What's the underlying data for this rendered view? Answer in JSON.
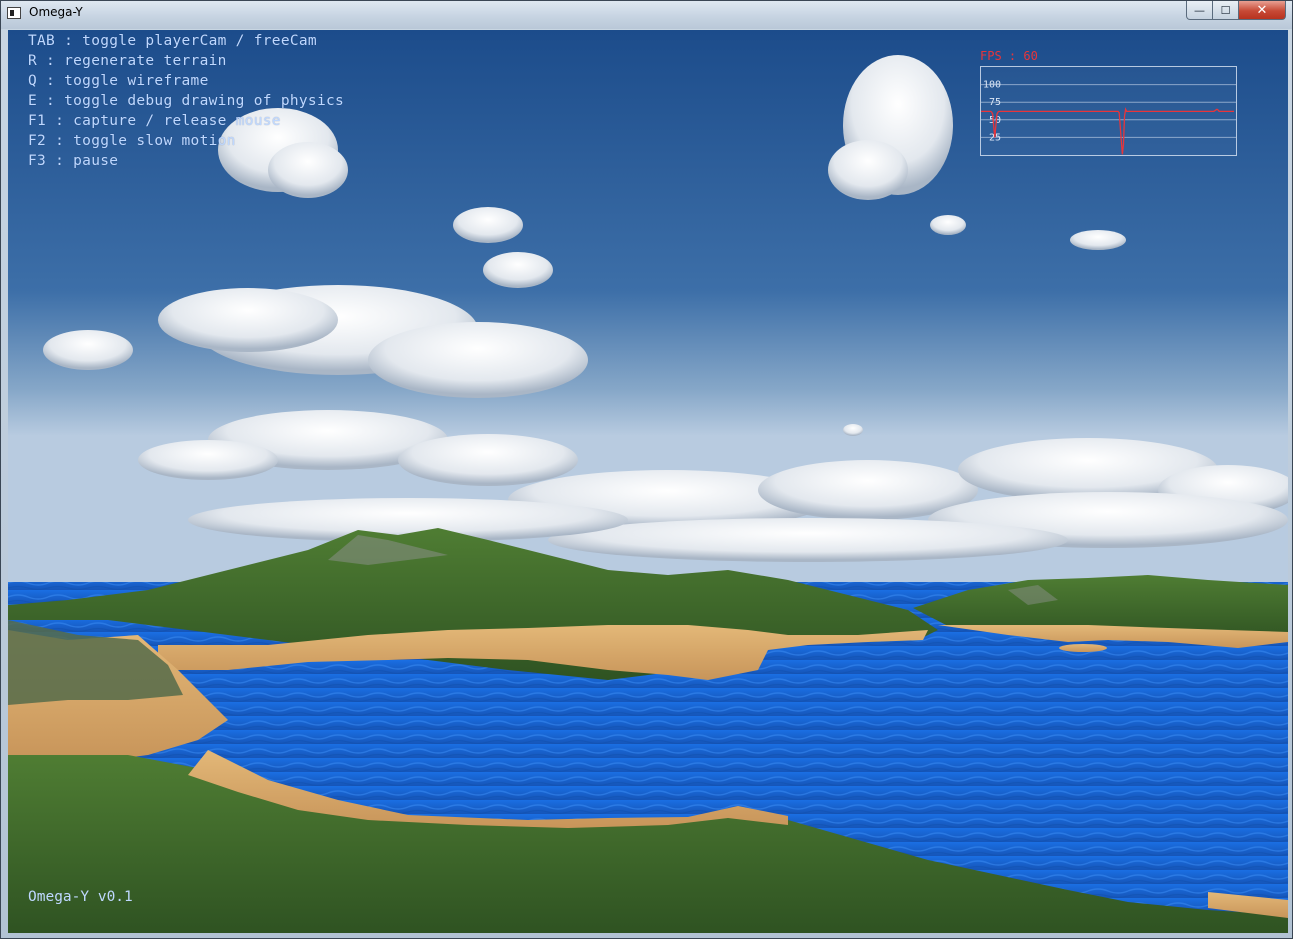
{
  "window": {
    "title": "Omega-Y",
    "controls": {
      "minimize_glyph": "—",
      "maximize_glyph": "☐",
      "close_glyph": "✕"
    }
  },
  "hud": {
    "help_lines": [
      "TAB : toggle playerCam / freeCam",
      "R : regenerate terrain",
      "Q : toggle wireframe",
      "E : toggle debug drawing of physics",
      "F1 : capture / release mouse",
      "F2 : toggle slow motion",
      "F3 : pause"
    ],
    "version": "Omega-Y v0.1"
  },
  "fps_graph": {
    "label": "FPS : 60",
    "y_ticks": [
      "100",
      "75",
      "50",
      "25"
    ],
    "ylim": [
      0,
      125
    ],
    "line_color": "#e8353b",
    "values": [
      62,
      62,
      62,
      62,
      62,
      62,
      62,
      62,
      62,
      62,
      61,
      58,
      40,
      25,
      42,
      58,
      61,
      62,
      62,
      62,
      62,
      62,
      62,
      62,
      62,
      62,
      62,
      62,
      62,
      62,
      62,
      62,
      62,
      62,
      62,
      62,
      62,
      62,
      62,
      62,
      62,
      62,
      62,
      62,
      62,
      62,
      62,
      62,
      62,
      62,
      62,
      62,
      62,
      62,
      62,
      62,
      62,
      62,
      62,
      62,
      62,
      62,
      62,
      62,
      62,
      62,
      62,
      62,
      62,
      62,
      62,
      62,
      62,
      62,
      62,
      62,
      62,
      62,
      62,
      62,
      62,
      62,
      62,
      62,
      62,
      62,
      62,
      62,
      62,
      62,
      62,
      62,
      62,
      62,
      62,
      62,
      62,
      62,
      62,
      62,
      62,
      62,
      62,
      62,
      62,
      62,
      62,
      62,
      62,
      62,
      62,
      62,
      62,
      62,
      62,
      62,
      62,
      62,
      62,
      62,
      62,
      62,
      62,
      62,
      62,
      62,
      62,
      62,
      62,
      62,
      60,
      40,
      20,
      1,
      15,
      55,
      65,
      62,
      62,
      62,
      62,
      62,
      62,
      62,
      62,
      62,
      62,
      62,
      62,
      62,
      62,
      62,
      62,
      62,
      62,
      62,
      62,
      62,
      62,
      62,
      62,
      62,
      62,
      62,
      62,
      62,
      62,
      62,
      62,
      62,
      62,
      62,
      62,
      62,
      62,
      62,
      62,
      62,
      62,
      62,
      62,
      62,
      62,
      62,
      62,
      62,
      62,
      62,
      62,
      62,
      62,
      62,
      62,
      62,
      62,
      62,
      62,
      62,
      62,
      62,
      62,
      62,
      62,
      62,
      62,
      62,
      62,
      62,
      62,
      62,
      62,
      62,
      62,
      62,
      62,
      62,
      62,
      62,
      62,
      62,
      63,
      64,
      65,
      64,
      62,
      62,
      62,
      62,
      62,
      62,
      62,
      62,
      62,
      62,
      62,
      62,
      62,
      62,
      62
    ]
  },
  "scene": {
    "sky_color_top": "#1c4f8f",
    "sky_color_horizon": "#9db9d3",
    "water_color": "#1f6bd6",
    "sand_color": "#d9aa6b",
    "grass_color": "#3f6a2b"
  }
}
